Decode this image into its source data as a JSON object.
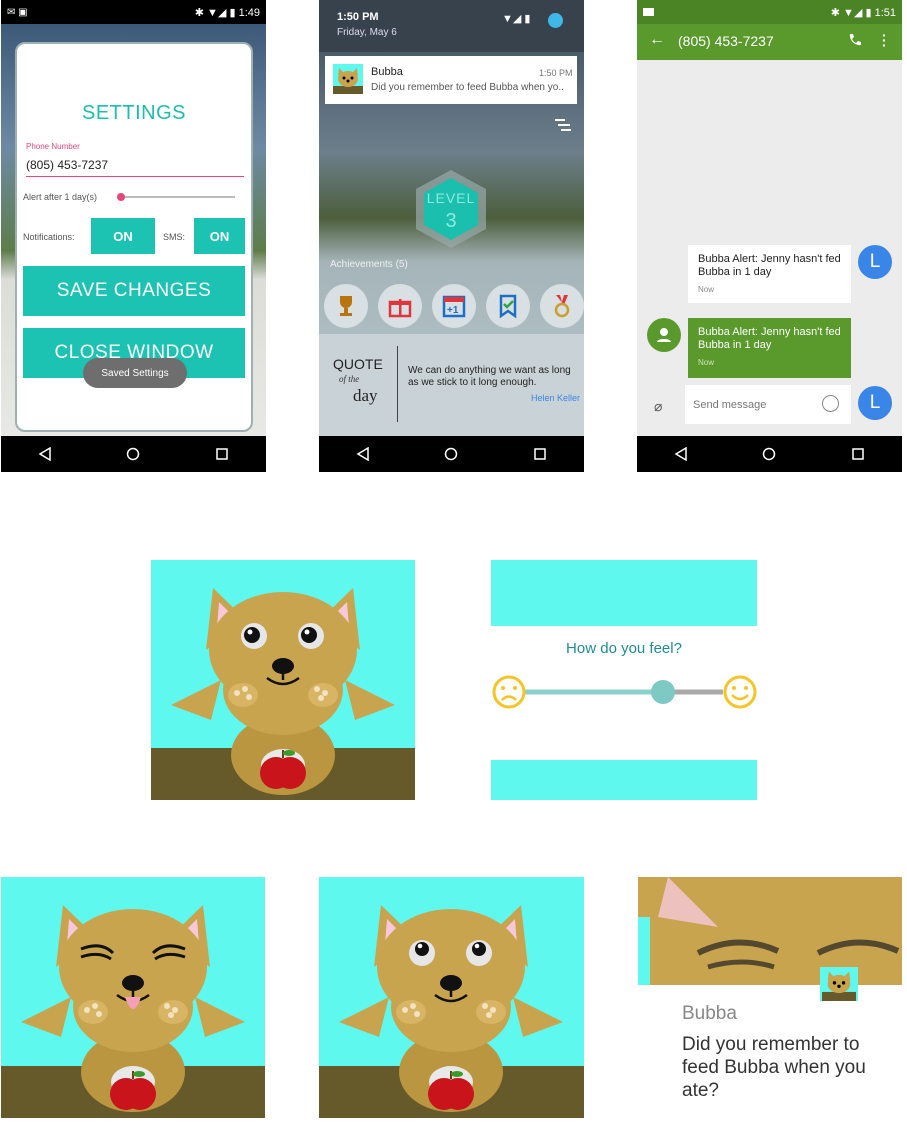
{
  "phone1": {
    "status": {
      "time": "1:49"
    },
    "dialog": {
      "title": "SETTINGS",
      "phone_label": "Phone Number",
      "phone_value": "(805) 453-7237",
      "alert_label": "Alert after 1 day(s)",
      "alert_value_days": 1,
      "notifications_label": "Notifications:",
      "notifications_toggle": "ON",
      "sms_label": "SMS:",
      "sms_toggle": "ON",
      "save_label": "SAVE CHANGES",
      "close_label": "CLOSE WINDOW"
    },
    "toast": "Saved Settings"
  },
  "phone2": {
    "shade": {
      "time": "1:50 PM",
      "date": "Friday, May 6"
    },
    "notification": {
      "app": "Bubba",
      "time": "1:50 PM",
      "text": "Did you remember to feed Bubba when yo.."
    },
    "level": {
      "label": "LEVEL",
      "value": "3"
    },
    "achievements_label": "Achievements (5)",
    "achievement_icons": [
      "trophy-icon",
      "gift-icon",
      "calendar-plus-one-icon",
      "bookmark-check-icon",
      "medal-icon"
    ],
    "quote": {
      "title_line1": "QUOTE",
      "title_line2": "of the",
      "title_line3": "day",
      "text": "We can do anything we want as long as we stick to it long enough.",
      "author": "Helen Keller"
    }
  },
  "phone3": {
    "status": {
      "time": "1:51"
    },
    "toolbar": {
      "title": "(805) 453-7237"
    },
    "messages": [
      {
        "text": "Bubba Alert: Jenny hasn't fed Bubba in 1 day",
        "time": "Now",
        "direction": "incoming",
        "avatar": "L"
      },
      {
        "text": "Bubba Alert: Jenny hasn't fed Bubba in 1 day",
        "time": "Now",
        "direction": "outgoing"
      }
    ],
    "compose": {
      "placeholder": "Send message",
      "avatar": "L"
    }
  },
  "feel": {
    "question": "How do you feel?",
    "slider_value": 0.75
  },
  "wear": {
    "app": "Bubba",
    "message": "Did you remember to feed Bubba when you ate?"
  },
  "colors": {
    "teal": "#1cc3b2",
    "pink": "#e8457e",
    "sms_green": "#5a9a2c",
    "cyan_bg": "#5ff8ef",
    "dog": "#c9a44f"
  }
}
